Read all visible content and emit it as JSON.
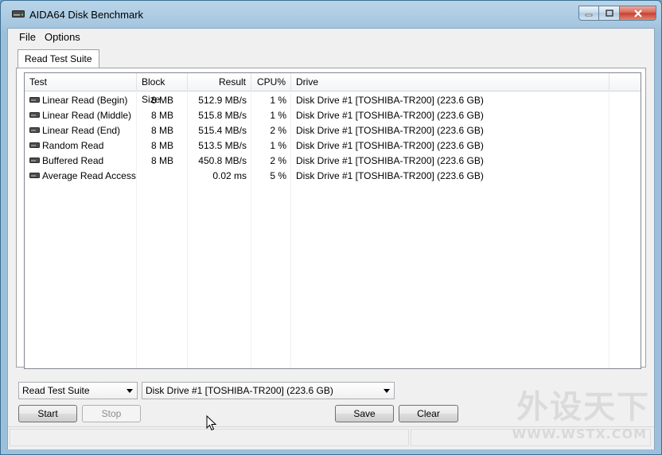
{
  "window": {
    "title": "AIDA64 Disk Benchmark",
    "icon": "drive-icon"
  },
  "menu": {
    "items": [
      "File",
      "Options"
    ]
  },
  "tabs": [
    {
      "label": "Read Test Suite",
      "active": true
    }
  ],
  "table": {
    "columns": [
      "Test",
      "Block Size",
      "Result",
      "CPU%",
      "Drive"
    ],
    "rows": [
      {
        "test": "Linear Read (Begin)",
        "block": "8 MB",
        "result": "512.9 MB/s",
        "cpu": "1 %",
        "drive": "Disk Drive #1  [TOSHIBA-TR200]  (223.6 GB)"
      },
      {
        "test": "Linear Read (Middle)",
        "block": "8 MB",
        "result": "515.8 MB/s",
        "cpu": "1 %",
        "drive": "Disk Drive #1  [TOSHIBA-TR200]  (223.6 GB)"
      },
      {
        "test": "Linear Read (End)",
        "block": "8 MB",
        "result": "515.4 MB/s",
        "cpu": "2 %",
        "drive": "Disk Drive #1  [TOSHIBA-TR200]  (223.6 GB)"
      },
      {
        "test": "Random Read",
        "block": "8 MB",
        "result": "513.5 MB/s",
        "cpu": "1 %",
        "drive": "Disk Drive #1  [TOSHIBA-TR200]  (223.6 GB)"
      },
      {
        "test": "Buffered Read",
        "block": "8 MB",
        "result": "450.8 MB/s",
        "cpu": "2 %",
        "drive": "Disk Drive #1  [TOSHIBA-TR200]  (223.6 GB)"
      },
      {
        "test": "Average Read Access",
        "block": "",
        "result": "0.02 ms",
        "cpu": "5 %",
        "drive": "Disk Drive #1  [TOSHIBA-TR200]  (223.6 GB)"
      }
    ]
  },
  "controls": {
    "suite_select": "Read Test Suite",
    "drive_select": "Disk Drive #1  [TOSHIBA-TR200]  (223.6 GB)",
    "start": "Start",
    "stop": "Stop",
    "save": "Save",
    "clear": "Clear"
  },
  "watermark": {
    "main": "外设天下",
    "sub": "WWW.WSTX.COM"
  },
  "colors": {
    "title_bar": "#a7c7e0",
    "close_button": "#c6402f",
    "window_bg": "#f0f0f0"
  }
}
